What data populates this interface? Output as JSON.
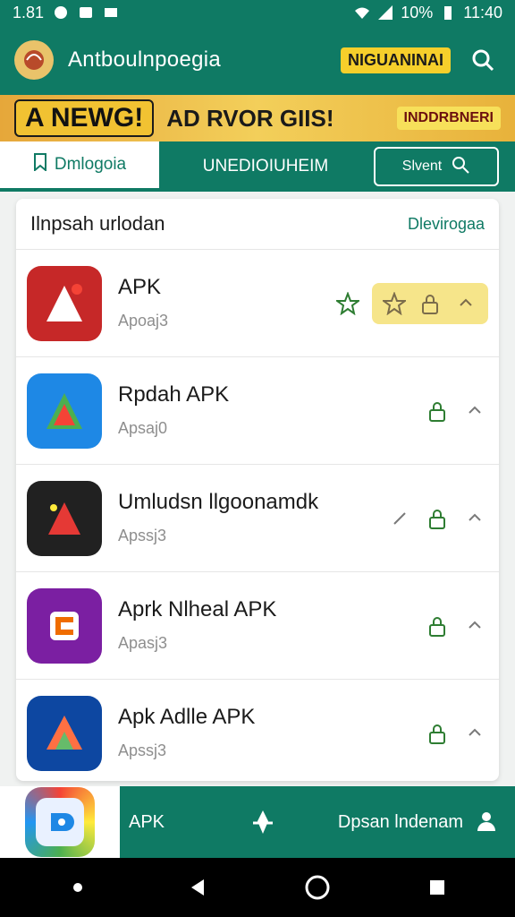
{
  "status_bar": {
    "time": "11:40",
    "left_text": "1.81",
    "battery": "10%"
  },
  "header": {
    "title": "Antboulnpoegia",
    "promo_text": "NIGUANINAI"
  },
  "banner": {
    "tag": "A NEWG!",
    "headline": "AD RVOR GIIS!",
    "sub": "INDDRBNERI"
  },
  "tabs": [
    {
      "label": "Dmlogoia"
    },
    {
      "label": "UNEDIOIUHEIM"
    }
  ],
  "search_button": {
    "label": "Slvent"
  },
  "section": {
    "title": "Ilnpsah urlodan",
    "action": "Dlevirogaa"
  },
  "apps": [
    {
      "name": "APK",
      "subtitle": "Apoaj3",
      "icon": "red-hand-app-icon",
      "color": "#c62828"
    },
    {
      "name": "Rpdah APK",
      "subtitle": "Apsaj0",
      "icon": "green-triangle-app-icon",
      "color": "#1e88e5"
    },
    {
      "name": "Umludsn llgoonamdk",
      "subtitle": "Apssj3",
      "icon": "black-red-app-icon",
      "color": "#212121"
    },
    {
      "name": "Aprk Nlheal APK",
      "subtitle": "Apasj3",
      "icon": "purple-orange-app-icon",
      "color": "#7b1fa2"
    },
    {
      "name": "Apk Adlle APK",
      "subtitle": "Apssj3",
      "icon": "colorful-fold-app-icon",
      "color": "#0d47a1"
    }
  ],
  "bottom_nav": {
    "apk_label": "APK",
    "right_label": "Dpsan lndenam"
  }
}
